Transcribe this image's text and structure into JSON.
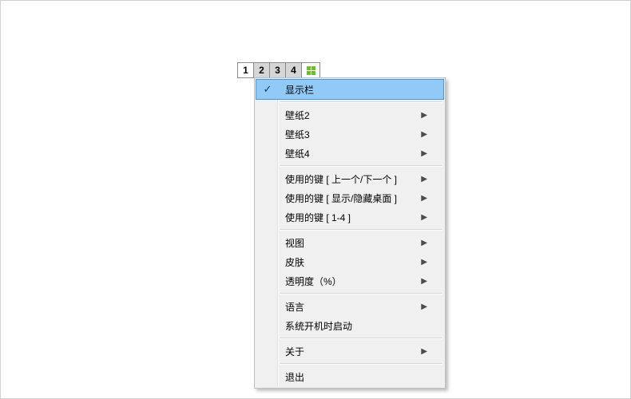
{
  "switcher": {
    "tabs": [
      {
        "label": "1",
        "active": true
      },
      {
        "label": "2",
        "active": false
      },
      {
        "label": "3",
        "active": false
      },
      {
        "label": "4",
        "active": false
      }
    ]
  },
  "menu": {
    "items": [
      {
        "label": "显示栏",
        "checked": true,
        "submenu": false,
        "highlight": true
      },
      {
        "sep": true
      },
      {
        "label": "壁纸2",
        "checked": false,
        "submenu": true
      },
      {
        "label": "壁纸3",
        "checked": false,
        "submenu": true
      },
      {
        "label": "壁纸4",
        "checked": false,
        "submenu": true
      },
      {
        "sep": true
      },
      {
        "label": "使用的键 [ 上一个/下一个 ]",
        "checked": false,
        "submenu": true
      },
      {
        "label": "使用的键 [ 显示/隐藏桌面 ]",
        "checked": false,
        "submenu": true
      },
      {
        "label": "使用的键 [ 1-4 ]",
        "checked": false,
        "submenu": true
      },
      {
        "sep": true
      },
      {
        "label": "视图",
        "checked": false,
        "submenu": true
      },
      {
        "label": "皮肤",
        "checked": false,
        "submenu": true
      },
      {
        "label": "透明度（%）",
        "checked": false,
        "submenu": true
      },
      {
        "sep": true
      },
      {
        "label": "语言",
        "checked": false,
        "submenu": true
      },
      {
        "label": "系统开机时启动",
        "checked": false,
        "submenu": false
      },
      {
        "sep": true
      },
      {
        "label": "关于",
        "checked": false,
        "submenu": true
      },
      {
        "sep": true
      },
      {
        "label": "退出",
        "checked": false,
        "submenu": false
      }
    ]
  }
}
